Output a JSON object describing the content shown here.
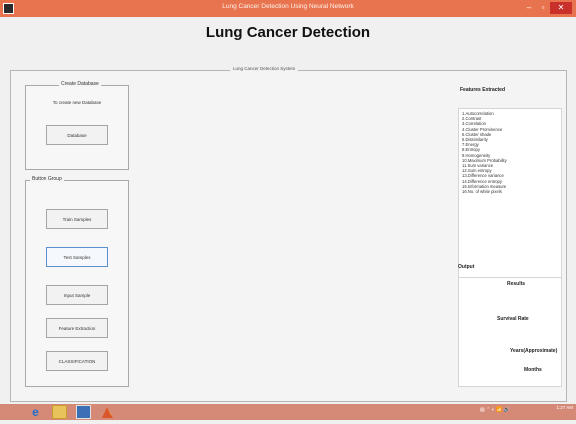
{
  "window": {
    "title": "Lung Cancer Detection Using Neural Network",
    "minimize_glyph": "–",
    "maximize_glyph": "▫",
    "close_glyph": "✕"
  },
  "page_title": "Lung Cancer Detection",
  "main_panel": {
    "title": "Lung Cancer Detection System"
  },
  "create_database": {
    "label": "Create Database",
    "caption": "To create new Database",
    "button": "Database"
  },
  "button_group": {
    "label": "Button Group",
    "buttons": {
      "train": "Train Samples",
      "test": "Test Samples",
      "input": "Input Sample",
      "feature": "Feature Extraction",
      "classification": "CLASSIFICATION"
    }
  },
  "features": {
    "title": "Features Extracted",
    "items": [
      "1.Autocorrelation",
      "2.Contrast",
      "3.Correlation",
      "4.Cluster Prominence",
      "5.Cluster shade",
      "6.Dissimilarity",
      "7.Energy",
      "8.Entropy",
      "9.Homogeneity",
      "10.Maximum Probability",
      "11.Sum variance",
      "12.Sum entropy",
      "13.Difference variance",
      "14.Difference entropy",
      "15.Information measure",
      "16.No. of white pixels"
    ]
  },
  "output": {
    "title": "Output",
    "results": "Results",
    "survival": "Survival Rate",
    "years": "Years(Approximate)",
    "months": "Months"
  },
  "taskbar": {
    "icons": [
      "internet-explorer-icon",
      "file-explorer-icon",
      "word-icon",
      "matlab-icon"
    ],
    "tray_text": "▤ ⌃ ◐ 📶 🔊",
    "clock": "1:27 AM"
  }
}
